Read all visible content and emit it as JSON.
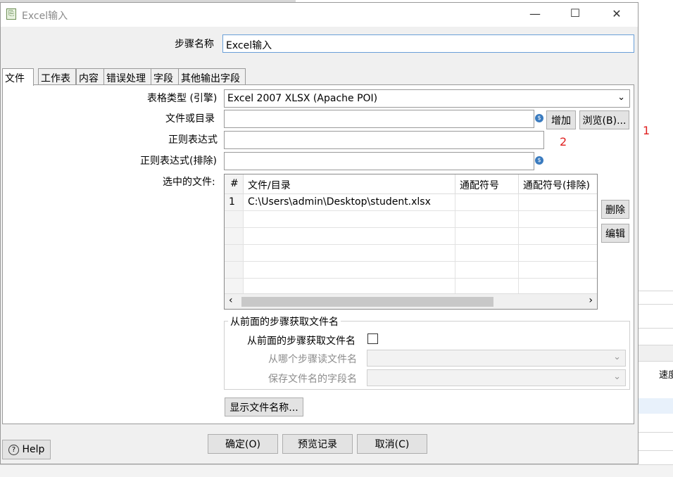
{
  "window": {
    "title": "Excel输入",
    "minimize_glyph": "—",
    "maximize_glyph": "☐",
    "close_glyph": "✕"
  },
  "step_name": {
    "label": "步骤名称",
    "value": "Excel输入"
  },
  "tabs": [
    {
      "label": "文件",
      "active": true
    },
    {
      "label": "工作表",
      "active": false
    },
    {
      "label": "内容",
      "active": false
    },
    {
      "label": "错误处理",
      "active": false
    },
    {
      "label": "字段",
      "active": false
    },
    {
      "label": "其他输出字段",
      "active": false
    }
  ],
  "file_tab": {
    "spreadsheet_type_label": "表格类型 (引擎)",
    "spreadsheet_type_value": "Excel 2007 XLSX (Apache POI)",
    "file_or_dir_label": "文件或目录",
    "file_or_dir_value": "",
    "add_button": "增加",
    "browse_button": "浏览(B)...",
    "regex_label": "正则表达式",
    "regex_value": "",
    "regex_exclude_label": "正则表达式(排除)",
    "regex_exclude_value": "",
    "selected_files_label": "选中的文件:",
    "table": {
      "headers": [
        "#",
        "文件/目录",
        "通配符号",
        "通配符号(排除)"
      ],
      "rows": [
        [
          "1",
          "C:\\Users\\admin\\Desktop\\student.xlsx",
          "",
          ""
        ]
      ]
    },
    "delete_button": "删除",
    "edit_button": "编辑",
    "group_title": "从前面的步骤获取文件名",
    "accept_checkbox_label": "从前面的步骤获取文件名",
    "accept_checked": false,
    "from_step_label": "从哪个步骤读文件名",
    "from_step_value": "",
    "field_label": "保存文件名的字段名",
    "field_value": "",
    "show_filenames_button": "显示文件名称..."
  },
  "annotations": {
    "mark1": "1",
    "mark2": "2"
  },
  "footer": {
    "help_button": "Help",
    "ok_button": "确定(O)",
    "preview_button": "预览记录",
    "cancel_button": "取消(C)"
  },
  "background": {
    "speed_header": "速度"
  },
  "colors": {
    "focus_border": "#6a9fd8",
    "annotation_red": "#e02020"
  }
}
